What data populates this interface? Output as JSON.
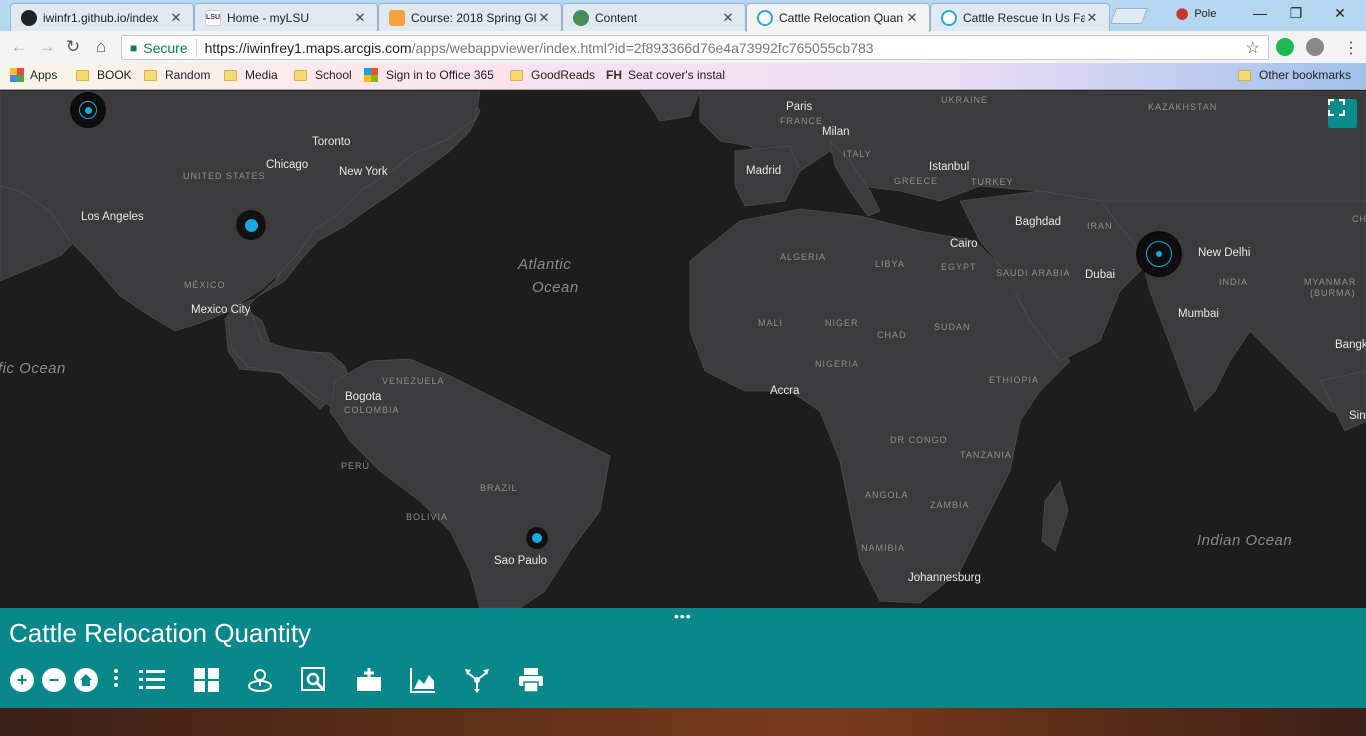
{
  "browser": {
    "tabs": [
      {
        "title": "iwinfr1.github.io/index",
        "icon": "github-icon",
        "active": false
      },
      {
        "title": "Home - myLSU",
        "icon": "lsu-icon",
        "active": false
      },
      {
        "title": "Course: 2018 Spring Gl",
        "icon": "moodle-icon",
        "active": false
      },
      {
        "title": "Content",
        "icon": "globe-icon",
        "active": false
      },
      {
        "title": "Cattle Relocation Quan",
        "icon": "arcgis-icon",
        "active": true
      },
      {
        "title": "Cattle Rescue In Us Far",
        "icon": "arcgis-icon",
        "active": false
      }
    ],
    "profile_name": "Pole",
    "secure_label": "Secure",
    "url_host": "https://iwinfrey1.maps.arcgis.com",
    "url_path": "/apps/webappviewer/index.html?id=2f893366d76e4a73992fc765055cb783",
    "bookmarks": [
      {
        "label": "Apps",
        "icon": "apps-grid-icon"
      },
      {
        "label": "BOOK",
        "icon": "folder-icon"
      },
      {
        "label": "Random",
        "icon": "folder-icon"
      },
      {
        "label": "Media",
        "icon": "folder-icon"
      },
      {
        "label": "School",
        "icon": "folder-icon"
      },
      {
        "label": "Sign in to Office 365",
        "icon": "office-icon"
      },
      {
        "label": "GoodReads",
        "icon": "folder-icon"
      },
      {
        "label": "Seat cover's instal",
        "icon": "fh-icon"
      }
    ],
    "other_bookmarks": "Other bookmarks",
    "fh_mark": "FH"
  },
  "map": {
    "cities": [
      "Paris",
      "Milan",
      "Madrid",
      "Istanbul",
      "Toronto",
      "Chicago",
      "New York",
      "Los Angeles",
      "Mexico City",
      "Baghdad",
      "Cairo",
      "Dubai",
      "New Delhi",
      "Mumbai",
      "Bogota",
      "Accra",
      "Sao Paulo",
      "Johannesburg",
      "Bangk",
      "Sin"
    ],
    "countries": [
      "UKRAINE",
      "KAZAKHSTAN",
      "FRANCE",
      "ITALY",
      "GREECE",
      "TURKEY",
      "UNITED STATES",
      "IRAN",
      "CH",
      "ALGERIA",
      "LIBYA",
      "EGYPT",
      "SAUDI ARABIA",
      "INDIA",
      "MYANMAR",
      "(BURMA)",
      "MÉXICO",
      "MALI",
      "NIGER",
      "CHAD",
      "SUDAN",
      "NIGERIA",
      "ETHIOPIA",
      "VENEZUELA",
      "COLOMBIA",
      "PERÚ",
      "BRAZIL",
      "BOLIVIA",
      "DR CONGO",
      "TANZANIA",
      "ANGOLA",
      "ZAMBIA",
      "NAMIBIA"
    ],
    "oceans": [
      "Atlantic",
      "Ocean",
      "fic Ocean",
      "Indian Ocean"
    ],
    "marker_color": "#1aa7e0"
  },
  "panel": {
    "title": "Cattle Relocation Quantity",
    "accent": "#08888a"
  }
}
